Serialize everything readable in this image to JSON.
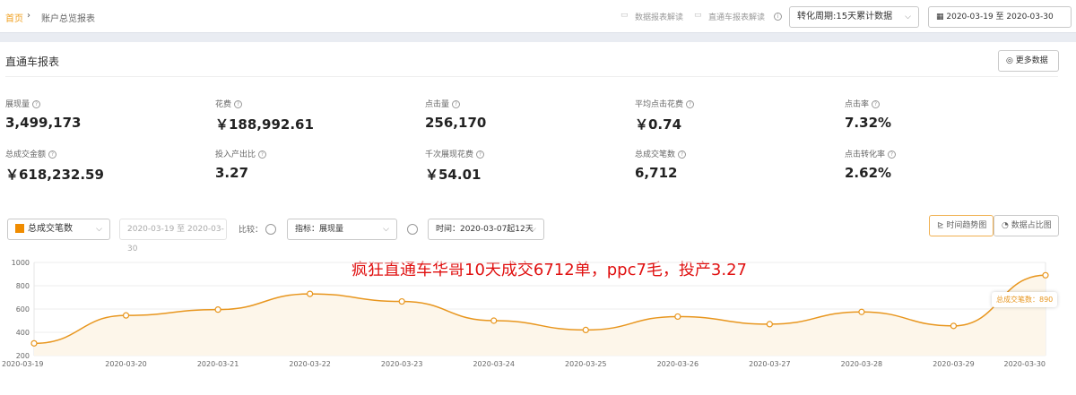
{
  "breadcrumb": {
    "home": "首页",
    "current": "账户总览报表"
  },
  "header": {
    "link1": "数据报表解读",
    "link2": "直通车报表解读",
    "period_select": "转化周期:15天累计数据",
    "date_range": "2020-03-19 至 2020-03-30"
  },
  "panel": {
    "title": "直通车报表",
    "more_button": "更多数据"
  },
  "metrics": [
    {
      "label": "展现量",
      "value": "3,499,173"
    },
    {
      "label": "花费",
      "value": "￥188,992.61"
    },
    {
      "label": "点击量",
      "value": "256,170"
    },
    {
      "label": "平均点击花费",
      "value": "￥0.74"
    },
    {
      "label": "点击率",
      "value": "7.32%"
    },
    {
      "label": "总成交金额",
      "value": "￥618,232.59"
    },
    {
      "label": "投入产出比",
      "value": "3.27"
    },
    {
      "label": "千次展现花费",
      "value": "￥54.01"
    },
    {
      "label": "总成交笔数",
      "value": "6,712"
    },
    {
      "label": "点击转化率",
      "value": "2.62%"
    }
  ],
  "controls": {
    "metric_select": "总成交笔数",
    "date_range": "2020-03-19 至 2020-03-30",
    "compare_label": "比较：",
    "indicator_select": "指标：展现量",
    "time_select": "时间：2020-03-07起12天",
    "trend_button": "时间趋势图",
    "ratio_button": "数据占比图"
  },
  "overlay_text": "疯狂直通车华哥10天成交6712单，ppc7毛，投产3.27",
  "colors": {
    "accent": "#f0a020",
    "line": "#e8961e"
  },
  "chart_data": {
    "type": "line",
    "x": [
      "2020-03-19",
      "2020-03-20",
      "2020-03-21",
      "2020-03-22",
      "2020-03-23",
      "2020-03-24",
      "2020-03-25",
      "2020-03-26",
      "2020-03-27",
      "2020-03-28",
      "2020-03-29",
      "2020-03-30"
    ],
    "series": [
      {
        "name": "总成交笔数",
        "values": [
          305,
          545,
          595,
          730,
          665,
          500,
          420,
          535,
          470,
          575,
          455,
          890
        ]
      }
    ],
    "yticks": [
      200,
      400,
      600,
      800,
      1000
    ],
    "ylim": [
      200,
      1000
    ],
    "grid": true,
    "tooltip": "总成交笔数：890"
  }
}
